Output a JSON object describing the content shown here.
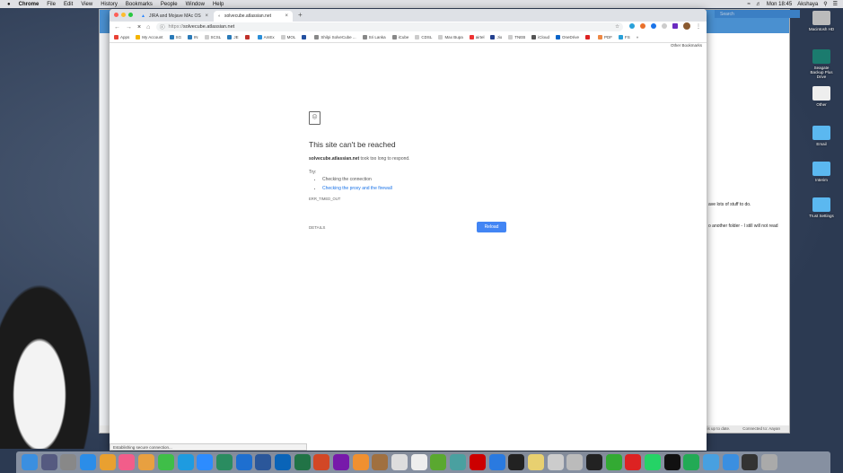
{
  "menubar": {
    "apple": "",
    "app": "Chrome",
    "items": [
      "File",
      "Edit",
      "View",
      "History",
      "Bookmarks",
      "People",
      "Window",
      "Help"
    ],
    "clock": "Mon 18:45",
    "user": "Akshaya"
  },
  "background_window": {
    "search_placeholder": "Search",
    "line1": "ave lots of stuff to do.",
    "line2": "o another folder - I still will not read",
    "status1": "er is up to date.",
    "status2": "Connected to: Aayan"
  },
  "browser": {
    "tabs": [
      {
        "title": "JIRA and Mojave MAc OS",
        "active": false
      },
      {
        "title": "solvecube.atlassian.net",
        "active": true
      }
    ],
    "new_tab": "+",
    "url_scheme": "https://",
    "url_host": "solvecube.atlassian.net",
    "bookmarks": [
      {
        "label": "Apps",
        "color": "#e94235"
      },
      {
        "label": "My Account",
        "color": "#f4b400"
      },
      {
        "label": "SG",
        "color": "#2a7ab8"
      },
      {
        "label": "IN",
        "color": "#2a7ab8"
      },
      {
        "label": "SCSL",
        "color": "#ccc"
      },
      {
        "label": "JE",
        "color": "#2a7ab8"
      },
      {
        "label": "",
        "color": "#c0302a"
      },
      {
        "label": "AmEx",
        "color": "#2a8ed8"
      },
      {
        "label": "MOL",
        "color": "#ccc"
      },
      {
        "label": "",
        "color": "#2350a0"
      },
      {
        "label": "Shilpi SolveCube ...",
        "color": "#888"
      },
      {
        "label": "Sri Lanka",
        "color": "#888"
      },
      {
        "label": "iCube",
        "color": "#888"
      },
      {
        "label": "CDSL",
        "color": "#ccc"
      },
      {
        "label": "Max Bupa",
        "color": "#ccc"
      },
      {
        "label": "airtel",
        "color": "#e33"
      },
      {
        "label": "Jio",
        "color": "#23408e"
      },
      {
        "label": "TNEB",
        "color": "#ccc"
      },
      {
        "label": "iCloud",
        "color": "#555"
      },
      {
        "label": "OneDrive",
        "color": "#0a64c8"
      },
      {
        "label": "",
        "color": "#d22"
      },
      {
        "label": "PDF",
        "color": "#e84"
      },
      {
        "label": "FS",
        "color": "#29a0d8"
      },
      {
        "label": "»",
        "color": "transparent"
      }
    ],
    "other_bookmarks": "Other Bookmarks",
    "error": {
      "title": "This site can't be reached",
      "host": "solvecube.atlassian.net",
      "message": " took too long to respond.",
      "try": "Try:",
      "tips": [
        "Checking the connection",
        "Checking the proxy and the firewall"
      ],
      "code": "ERR_TIMED_OUT",
      "details": "DETAILS",
      "reload": "Reload"
    },
    "status": "Establishing secure connection..."
  },
  "desktop_icons": [
    {
      "label": "Macintosh HD",
      "color": "#bbb"
    },
    {
      "label": "Seagate Backup Plus Drive",
      "color": "#1b7b6e"
    },
    {
      "label": "Other",
      "color": "#eee"
    },
    {
      "label": "Email",
      "color": "#5bb8f0"
    },
    {
      "label": "Interim",
      "color": "#5bb8f0"
    },
    {
      "label": "Trust Settings",
      "color": "#5bb8f0"
    }
  ],
  "dock": [
    "#3b8fe0",
    "#555a80",
    "#888",
    "#2b8de8",
    "#e9a030",
    "#f25d8a",
    "#e8a040",
    "#3fbe48",
    "#1e9be0",
    "#2d8cff",
    "#2a8c60",
    "#1e6fd0",
    "#2b579a",
    "#0a64b8",
    "#217346",
    "#d24726",
    "#7719aa",
    "#f09030",
    "#a07040",
    "#ddd",
    "#eee",
    "#5aa830",
    "#4aa0a0",
    "#c00",
    "#2a7ae0",
    "#222",
    "#e8d070",
    "#ccc",
    "#bbb",
    "#222",
    "#3a3",
    "#d22",
    "#25d366",
    "#111",
    "#2a5",
    "#48a0e0",
    "#3b8fe0",
    "#333",
    "#aaa"
  ]
}
